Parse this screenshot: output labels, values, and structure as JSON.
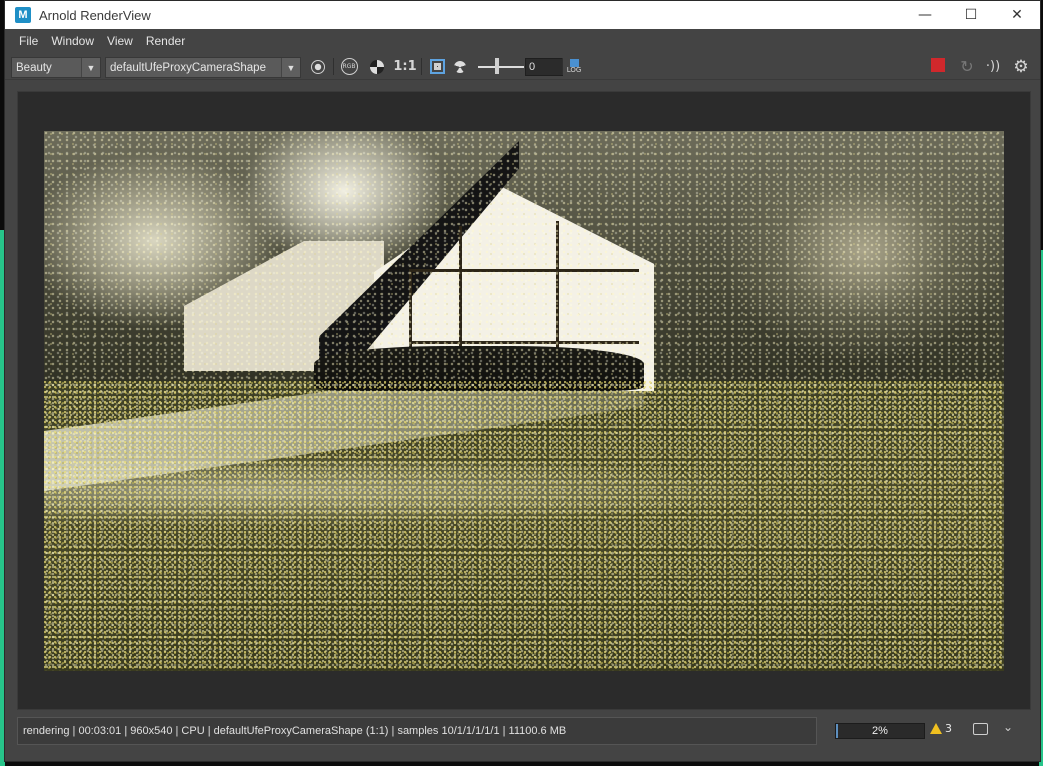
{
  "window": {
    "title": "Arnold RenderView",
    "app_icon_letter": "M",
    "controls": {
      "minimize": "—",
      "maximize": "☐",
      "close": "✕"
    }
  },
  "menubar": {
    "items": [
      "File",
      "Window",
      "View",
      "Render"
    ]
  },
  "toolbar": {
    "aov_select": "Beauty",
    "camera_select": "defaultUfeProxyCameraShape",
    "rgb_label": "RGB",
    "ratio_label": "1:1",
    "exposure_value": "0",
    "log_label": "LOG",
    "icons": [
      "display-sphere-icon",
      "rgb-channel-icon",
      "checker-icon",
      "crop-region-icon",
      "exposure-icon",
      "log-icon",
      "stop-render-icon",
      "refresh-icon",
      "ipr-icon",
      "settings-icon"
    ],
    "accent_stop_color": "#d0282c"
  },
  "status": {
    "text": "rendering | 00:03:01 |  960x540 | CPU | defaultUfeProxyCameraShape (1:1) | samples 10/1/1/1/1/1 | 11100.6 MB",
    "progress_percent": 2,
    "progress_label": "2%",
    "warnings_count": "3"
  },
  "render_image": {
    "description_icon": "render-image"
  }
}
